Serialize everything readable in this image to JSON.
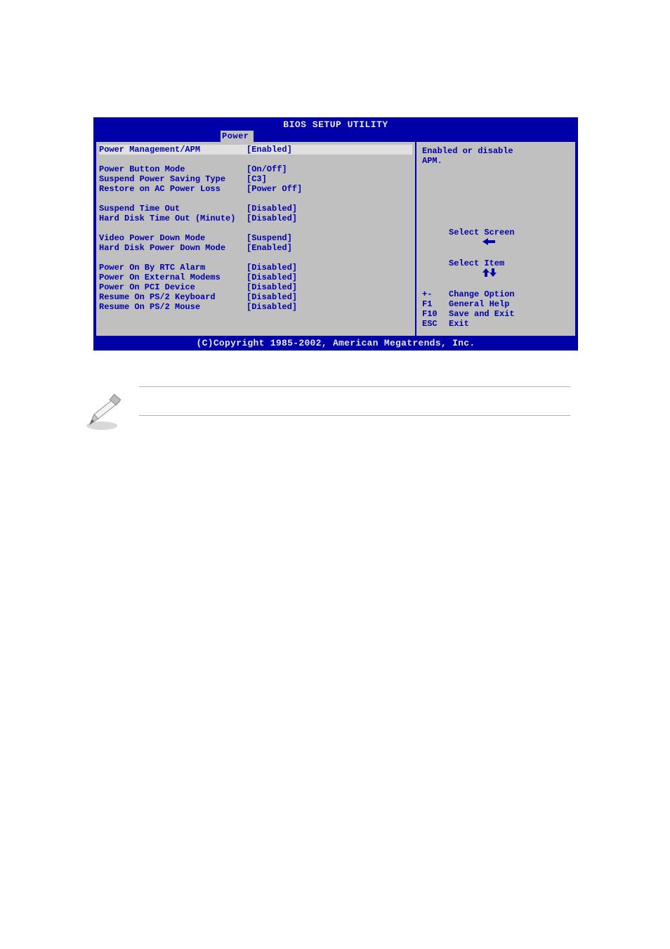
{
  "title": "BIOS SETUP UTILITY",
  "active_tab": "Power",
  "help": {
    "line1": "Enabled or disable",
    "line2": "APM."
  },
  "settings": {
    "group1": [
      {
        "label": "Power Management/APM",
        "value": "[Enabled]",
        "highlight": true
      }
    ],
    "group2": [
      {
        "label": "Power Button Mode",
        "value": "[On/Off]"
      },
      {
        "label": "Suspend Power Saving Type",
        "value": "[C3]"
      },
      {
        "label": "Restore on AC Power Loss",
        "value": "[Power Off]"
      }
    ],
    "group3": [
      {
        "label": "Suspend Time Out",
        "value": "[Disabled]"
      },
      {
        "label": "Hard Disk Time Out (Minute)",
        "value": "[Disabled]"
      }
    ],
    "group4": [
      {
        "label": "Video Power Down Mode",
        "value": "[Suspend]"
      },
      {
        "label": "Hard Disk Power Down Mode",
        "value": "[Enabled]"
      }
    ],
    "group5": [
      {
        "label": "Power On By RTC Alarm",
        "value": "[Disabled]"
      },
      {
        "label": "Power On External Modems",
        "value": "[Disabled]"
      },
      {
        "label": "Power On PCI Device",
        "value": "[Disabled]"
      },
      {
        "label": "Resume On PS/2 Keyboard",
        "value": "[Disabled]"
      },
      {
        "label": "Resume On PS/2 Mouse",
        "value": "[Disabled]"
      }
    ]
  },
  "nav": [
    {
      "key_icon": "arrow-left",
      "key_text": "",
      "desc": "Select Screen"
    },
    {
      "key_icon": "arrow-updown",
      "key_text": "",
      "desc": "Select Item"
    },
    {
      "key_icon": "",
      "key_text": "+-",
      "desc": "Change Option"
    },
    {
      "key_icon": "",
      "key_text": "F1",
      "desc": "General Help"
    },
    {
      "key_icon": "",
      "key_text": "F10",
      "desc": "Save and Exit"
    },
    {
      "key_icon": "",
      "key_text": "ESC",
      "desc": "Exit"
    }
  ],
  "copyright": "(C)Copyright 1985-2002, American Megatrends, Inc."
}
